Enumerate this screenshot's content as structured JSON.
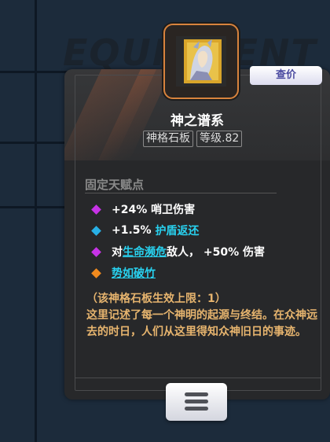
{
  "background_watermark": "EQUIPMENT",
  "item": {
    "price_tab_label": "查价",
    "name": "神之谱系",
    "tags": [
      "神格石板",
      "等级.82"
    ],
    "icon": "deity-portrait-icon",
    "rarity_color": "#d8833d"
  },
  "section": {
    "title": "固定天赋点"
  },
  "stats": [
    {
      "icon": "purple-diamond-icon",
      "color": "#c633e6",
      "parts": [
        "+24% 哨卫伤害"
      ]
    },
    {
      "icon": "cyan-diamond-icon",
      "color": "#28b0e6",
      "prefix": "+1.5% ",
      "highlight": "护盾返还"
    },
    {
      "icon": "purple-diamond-icon",
      "color": "#c633e6",
      "prefix": "对",
      "link": "生命濒危",
      "suffix": "敌人， +50% 伤害"
    },
    {
      "icon": "orange-diamond-icon",
      "color": "#f08a1e",
      "link": "势如破竹"
    }
  ],
  "description": {
    "limit": "（该神格石板生效上限：1）",
    "lore": "这里记述了每一个神明的起源与终结。在众神远去的时日，人们从这里得知众神旧日的事迹。"
  },
  "menu_button_icon": "hamburger-menu-icon"
}
